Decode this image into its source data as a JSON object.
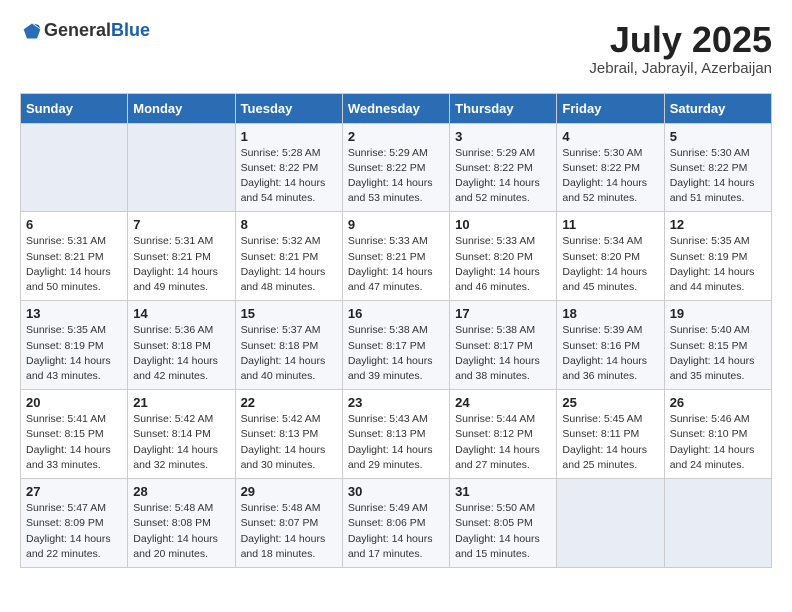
{
  "header": {
    "logo_general": "General",
    "logo_blue": "Blue",
    "month": "July 2025",
    "location": "Jebrail, Jabrayil, Azerbaijan"
  },
  "weekdays": [
    "Sunday",
    "Monday",
    "Tuesday",
    "Wednesday",
    "Thursday",
    "Friday",
    "Saturday"
  ],
  "weeks": [
    [
      {
        "day": "",
        "sunrise": "",
        "sunset": "",
        "daylight": ""
      },
      {
        "day": "",
        "sunrise": "",
        "sunset": "",
        "daylight": ""
      },
      {
        "day": "1",
        "sunrise": "Sunrise: 5:28 AM",
        "sunset": "Sunset: 8:22 PM",
        "daylight": "Daylight: 14 hours and 54 minutes."
      },
      {
        "day": "2",
        "sunrise": "Sunrise: 5:29 AM",
        "sunset": "Sunset: 8:22 PM",
        "daylight": "Daylight: 14 hours and 53 minutes."
      },
      {
        "day": "3",
        "sunrise": "Sunrise: 5:29 AM",
        "sunset": "Sunset: 8:22 PM",
        "daylight": "Daylight: 14 hours and 52 minutes."
      },
      {
        "day": "4",
        "sunrise": "Sunrise: 5:30 AM",
        "sunset": "Sunset: 8:22 PM",
        "daylight": "Daylight: 14 hours and 52 minutes."
      },
      {
        "day": "5",
        "sunrise": "Sunrise: 5:30 AM",
        "sunset": "Sunset: 8:22 PM",
        "daylight": "Daylight: 14 hours and 51 minutes."
      }
    ],
    [
      {
        "day": "6",
        "sunrise": "Sunrise: 5:31 AM",
        "sunset": "Sunset: 8:21 PM",
        "daylight": "Daylight: 14 hours and 50 minutes."
      },
      {
        "day": "7",
        "sunrise": "Sunrise: 5:31 AM",
        "sunset": "Sunset: 8:21 PM",
        "daylight": "Daylight: 14 hours and 49 minutes."
      },
      {
        "day": "8",
        "sunrise": "Sunrise: 5:32 AM",
        "sunset": "Sunset: 8:21 PM",
        "daylight": "Daylight: 14 hours and 48 minutes."
      },
      {
        "day": "9",
        "sunrise": "Sunrise: 5:33 AM",
        "sunset": "Sunset: 8:21 PM",
        "daylight": "Daylight: 14 hours and 47 minutes."
      },
      {
        "day": "10",
        "sunrise": "Sunrise: 5:33 AM",
        "sunset": "Sunset: 8:20 PM",
        "daylight": "Daylight: 14 hours and 46 minutes."
      },
      {
        "day": "11",
        "sunrise": "Sunrise: 5:34 AM",
        "sunset": "Sunset: 8:20 PM",
        "daylight": "Daylight: 14 hours and 45 minutes."
      },
      {
        "day": "12",
        "sunrise": "Sunrise: 5:35 AM",
        "sunset": "Sunset: 8:19 PM",
        "daylight": "Daylight: 14 hours and 44 minutes."
      }
    ],
    [
      {
        "day": "13",
        "sunrise": "Sunrise: 5:35 AM",
        "sunset": "Sunset: 8:19 PM",
        "daylight": "Daylight: 14 hours and 43 minutes."
      },
      {
        "day": "14",
        "sunrise": "Sunrise: 5:36 AM",
        "sunset": "Sunset: 8:18 PM",
        "daylight": "Daylight: 14 hours and 42 minutes."
      },
      {
        "day": "15",
        "sunrise": "Sunrise: 5:37 AM",
        "sunset": "Sunset: 8:18 PM",
        "daylight": "Daylight: 14 hours and 40 minutes."
      },
      {
        "day": "16",
        "sunrise": "Sunrise: 5:38 AM",
        "sunset": "Sunset: 8:17 PM",
        "daylight": "Daylight: 14 hours and 39 minutes."
      },
      {
        "day": "17",
        "sunrise": "Sunrise: 5:38 AM",
        "sunset": "Sunset: 8:17 PM",
        "daylight": "Daylight: 14 hours and 38 minutes."
      },
      {
        "day": "18",
        "sunrise": "Sunrise: 5:39 AM",
        "sunset": "Sunset: 8:16 PM",
        "daylight": "Daylight: 14 hours and 36 minutes."
      },
      {
        "day": "19",
        "sunrise": "Sunrise: 5:40 AM",
        "sunset": "Sunset: 8:15 PM",
        "daylight": "Daylight: 14 hours and 35 minutes."
      }
    ],
    [
      {
        "day": "20",
        "sunrise": "Sunrise: 5:41 AM",
        "sunset": "Sunset: 8:15 PM",
        "daylight": "Daylight: 14 hours and 33 minutes."
      },
      {
        "day": "21",
        "sunrise": "Sunrise: 5:42 AM",
        "sunset": "Sunset: 8:14 PM",
        "daylight": "Daylight: 14 hours and 32 minutes."
      },
      {
        "day": "22",
        "sunrise": "Sunrise: 5:42 AM",
        "sunset": "Sunset: 8:13 PM",
        "daylight": "Daylight: 14 hours and 30 minutes."
      },
      {
        "day": "23",
        "sunrise": "Sunrise: 5:43 AM",
        "sunset": "Sunset: 8:13 PM",
        "daylight": "Daylight: 14 hours and 29 minutes."
      },
      {
        "day": "24",
        "sunrise": "Sunrise: 5:44 AM",
        "sunset": "Sunset: 8:12 PM",
        "daylight": "Daylight: 14 hours and 27 minutes."
      },
      {
        "day": "25",
        "sunrise": "Sunrise: 5:45 AM",
        "sunset": "Sunset: 8:11 PM",
        "daylight": "Daylight: 14 hours and 25 minutes."
      },
      {
        "day": "26",
        "sunrise": "Sunrise: 5:46 AM",
        "sunset": "Sunset: 8:10 PM",
        "daylight": "Daylight: 14 hours and 24 minutes."
      }
    ],
    [
      {
        "day": "27",
        "sunrise": "Sunrise: 5:47 AM",
        "sunset": "Sunset: 8:09 PM",
        "daylight": "Daylight: 14 hours and 22 minutes."
      },
      {
        "day": "28",
        "sunrise": "Sunrise: 5:48 AM",
        "sunset": "Sunset: 8:08 PM",
        "daylight": "Daylight: 14 hours and 20 minutes."
      },
      {
        "day": "29",
        "sunrise": "Sunrise: 5:48 AM",
        "sunset": "Sunset: 8:07 PM",
        "daylight": "Daylight: 14 hours and 18 minutes."
      },
      {
        "day": "30",
        "sunrise": "Sunrise: 5:49 AM",
        "sunset": "Sunset: 8:06 PM",
        "daylight": "Daylight: 14 hours and 17 minutes."
      },
      {
        "day": "31",
        "sunrise": "Sunrise: 5:50 AM",
        "sunset": "Sunset: 8:05 PM",
        "daylight": "Daylight: 14 hours and 15 minutes."
      },
      {
        "day": "",
        "sunrise": "",
        "sunset": "",
        "daylight": ""
      },
      {
        "day": "",
        "sunrise": "",
        "sunset": "",
        "daylight": ""
      }
    ]
  ]
}
